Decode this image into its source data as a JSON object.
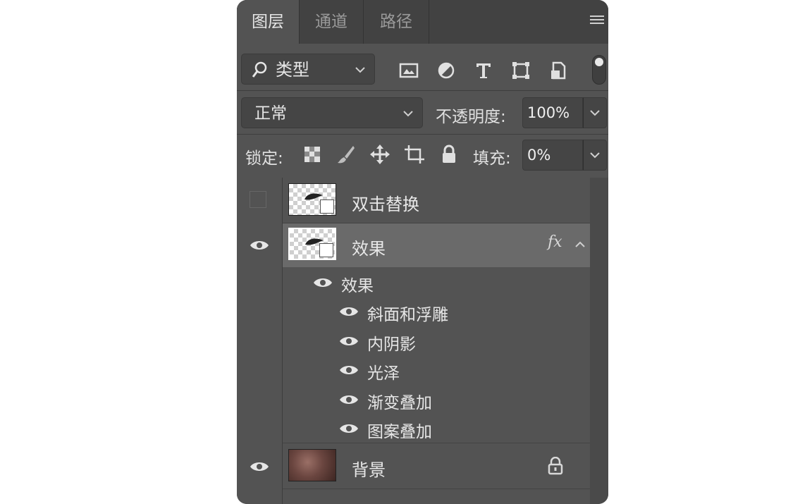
{
  "tabs": [
    {
      "label": "图层",
      "active": true
    },
    {
      "label": "通道",
      "active": false
    },
    {
      "label": "路径",
      "active": false
    }
  ],
  "filter": {
    "kind_label": "类型"
  },
  "filter_icons": [
    "image-filter-icon",
    "adjustment-filter-icon",
    "type-filter-icon",
    "shape-filter-icon",
    "smart-object-filter-icon"
  ],
  "blend_mode": "正常",
  "opacity": {
    "label": "不透明度:",
    "value": "100%"
  },
  "lock": {
    "label": "锁定:",
    "icons": [
      "lock-transparent-icon",
      "lock-image-icon",
      "lock-position-icon",
      "lock-artboard-icon",
      "lock-all-icon"
    ]
  },
  "fill": {
    "label": "填充:",
    "value": "0%"
  },
  "layers": [
    {
      "name": "双击替换",
      "visible": false,
      "selected": false,
      "smart_object": true
    },
    {
      "name": "效果",
      "visible": true,
      "selected": true,
      "smart_object": true,
      "fx": "fx"
    },
    {
      "name": "背景",
      "visible": true,
      "selected": false,
      "locked": true
    }
  ],
  "effects_group": "效果",
  "effects": [
    "斜面和浮雕",
    "内阴影",
    "光泽",
    "渐变叠加",
    "图案叠加"
  ],
  "colors": {
    "panel": "#535353",
    "selected_row": "#6a6a6a",
    "tab_bar": "#424242"
  }
}
